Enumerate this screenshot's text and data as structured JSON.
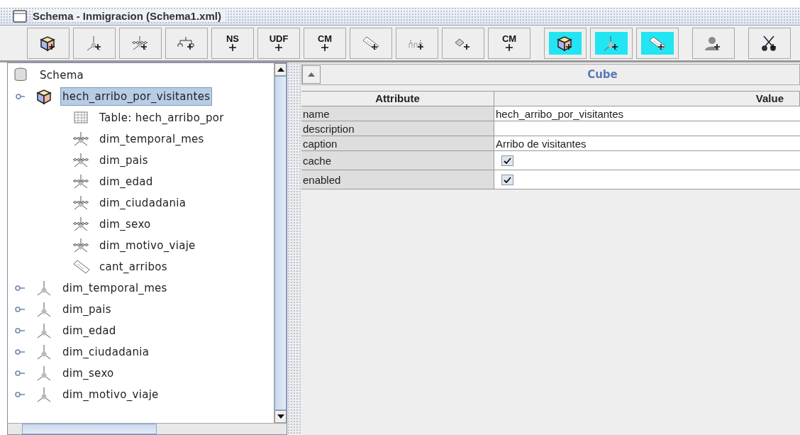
{
  "window": {
    "title": "Schema - Inmigracion (Schema1.xml)"
  },
  "toolbar": [
    {
      "kind": "cube",
      "highlighted": false
    },
    {
      "kind": "dimension",
      "highlighted": false
    },
    {
      "kind": "dimension-usage",
      "highlighted": false
    },
    {
      "kind": "hierarchy",
      "highlighted": false
    },
    {
      "kind": "text",
      "label": "NS",
      "highlighted": false
    },
    {
      "kind": "text",
      "label": "UDF",
      "highlighted": false
    },
    {
      "kind": "text",
      "label": "CM",
      "highlighted": false
    },
    {
      "kind": "measure",
      "highlighted": false
    },
    {
      "kind": "level",
      "highlighted": false
    },
    {
      "kind": "property",
      "highlighted": false
    },
    {
      "kind": "text-property",
      "label": "CM",
      "highlighted": false
    },
    {
      "kind": "cube",
      "highlighted": true
    },
    {
      "kind": "dimension",
      "highlighted": true
    },
    {
      "kind": "measure",
      "highlighted": true
    },
    {
      "kind": "user",
      "highlighted": false
    },
    {
      "kind": "scissors",
      "highlighted": false
    }
  ],
  "tree": {
    "label": "Schema",
    "kind": "schema",
    "children": [
      {
        "label": "hech_arribo_por_visitantes",
        "kind": "cube",
        "selected": true,
        "expanded": true,
        "children": [
          {
            "label": "Table: hech_arribo_por",
            "kind": "table",
            "selected": false
          },
          {
            "label": "dim_temporal_mes",
            "kind": "dimension-usage",
            "selected": false
          },
          {
            "label": "dim_pais",
            "kind": "dimension-usage",
            "selected": false
          },
          {
            "label": "dim_edad",
            "kind": "dimension-usage",
            "selected": false
          },
          {
            "label": "dim_ciudadania",
            "kind": "dimension-usage",
            "selected": false
          },
          {
            "label": "dim_sexo",
            "kind": "dimension-usage",
            "selected": false
          },
          {
            "label": "dim_motivo_viaje",
            "kind": "dimension-usage",
            "selected": false
          },
          {
            "label": "cant_arribos",
            "kind": "measure",
            "selected": false
          }
        ]
      },
      {
        "label": "dim_temporal_mes",
        "kind": "dimension",
        "selected": false,
        "expanded": false
      },
      {
        "label": "dim_pais",
        "kind": "dimension",
        "selected": false,
        "expanded": false
      },
      {
        "label": "dim_edad",
        "kind": "dimension",
        "selected": false,
        "expanded": false
      },
      {
        "label": "dim_ciudadania",
        "kind": "dimension",
        "selected": false,
        "expanded": false
      },
      {
        "label": "dim_sexo",
        "kind": "dimension",
        "selected": false,
        "expanded": false
      },
      {
        "label": "dim_motivo_viaje",
        "kind": "dimension",
        "selected": false,
        "expanded": false
      }
    ]
  },
  "details": {
    "title": "Cube",
    "columns": [
      "Attribute",
      "Value"
    ],
    "rows": [
      {
        "attribute": "name",
        "kind": "text",
        "value": "hech_arribo_por_visitantes"
      },
      {
        "attribute": "description",
        "kind": "text"
      },
      {
        "attribute": "caption",
        "kind": "text",
        "value": "Arribo de visitantes"
      },
      {
        "attribute": "cache",
        "kind": "checkbox",
        "checked": true
      },
      {
        "attribute": "enabled",
        "kind": "checkbox",
        "checked": true
      }
    ]
  }
}
